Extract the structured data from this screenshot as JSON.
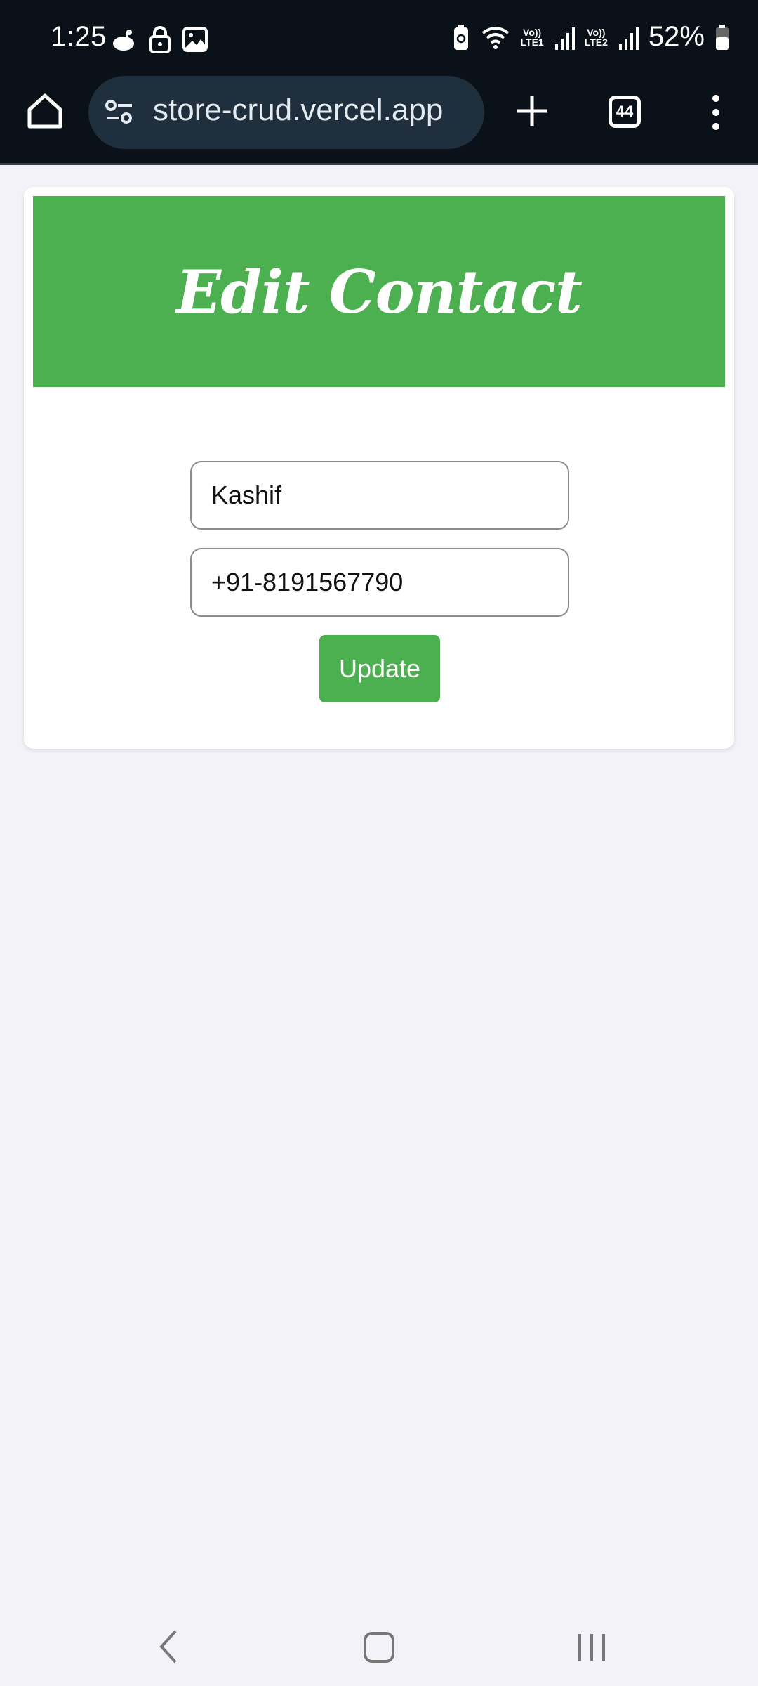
{
  "status_bar": {
    "time": "1:25",
    "sim1_label": "LTE1",
    "sim2_label": "LTE2",
    "volte_label": "Vo))",
    "battery_percent": "52%",
    "icons": [
      "notification-app-icon",
      "lock-icon",
      "gallery-icon",
      "battery-saver-icon",
      "wifi-icon",
      "signal-icon",
      "battery-icon"
    ]
  },
  "browser": {
    "url": "store-crud.vercel.app",
    "tab_count": "44"
  },
  "page": {
    "title": "Edit Contact",
    "name_value": "Kashif",
    "phone_value": "+91-8191567790",
    "update_label": "Update",
    "accent_color": "#4caf50"
  },
  "nav": {
    "icons": [
      "back-icon",
      "home-icon",
      "recent-apps-icon"
    ]
  }
}
